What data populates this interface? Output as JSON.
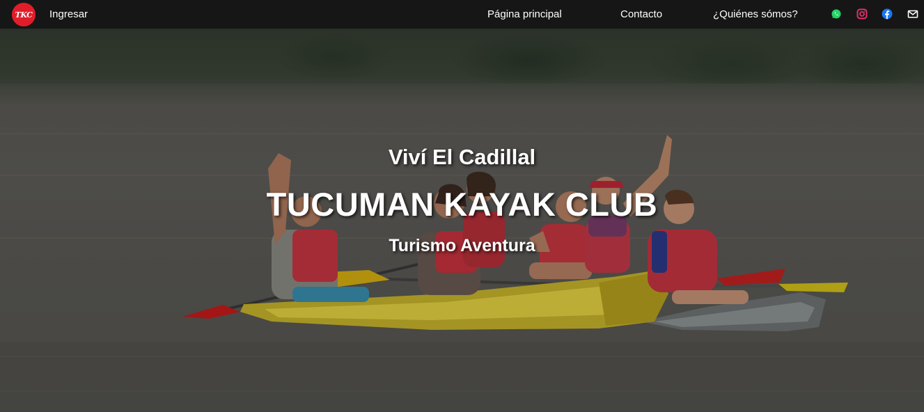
{
  "nav": {
    "logo_text": "TKC",
    "login_label": "Ingresar",
    "links": [
      "Página principal",
      "Contacto",
      "¿Quiénes sómos?"
    ]
  },
  "social": [
    {
      "icon": "whatsapp-icon",
      "color": "#25d366"
    },
    {
      "icon": "instagram-icon",
      "color": "#e1306c"
    },
    {
      "icon": "facebook-icon",
      "color": "#1877f2"
    },
    {
      "icon": "mail-icon",
      "color": "#ffffff"
    }
  ],
  "hero": {
    "tagline": "Viví El Cadillal",
    "title": "TUCUMAN KAYAK CLUB",
    "subtitle": "Turismo Aventura"
  },
  "colors": {
    "navbar": "#161616",
    "logo": "#e11d2a",
    "text": "#ffffff"
  }
}
